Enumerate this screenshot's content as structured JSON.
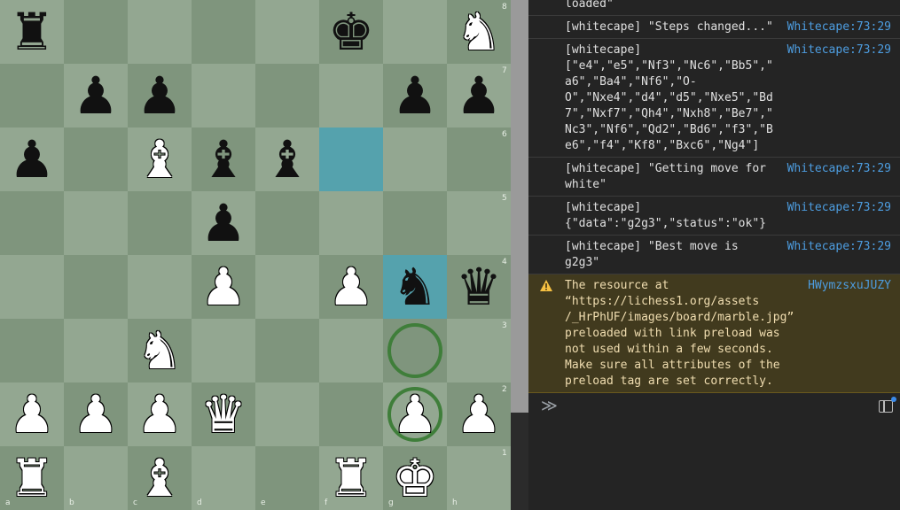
{
  "board": {
    "files": [
      "a",
      "b",
      "c",
      "d",
      "e",
      "f",
      "g",
      "h"
    ],
    "ranks": [
      "8",
      "7",
      "6",
      "5",
      "4",
      "3",
      "2",
      "1"
    ],
    "pieces": [
      {
        "square": "a8",
        "color": "black",
        "type": "rook",
        "glyph": "♜",
        "icon": "rook-icon"
      },
      {
        "square": "f8",
        "color": "black",
        "type": "king",
        "glyph": "♚",
        "icon": "king-icon"
      },
      {
        "square": "h8",
        "color": "white",
        "type": "knight",
        "glyph": "♞",
        "icon": "knight-icon"
      },
      {
        "square": "b7",
        "color": "black",
        "type": "pawn",
        "glyph": "♟",
        "icon": "pawn-icon"
      },
      {
        "square": "c7",
        "color": "black",
        "type": "pawn",
        "glyph": "♟",
        "icon": "pawn-icon"
      },
      {
        "square": "g7",
        "color": "black",
        "type": "pawn",
        "glyph": "♟",
        "icon": "pawn-icon"
      },
      {
        "square": "h7",
        "color": "black",
        "type": "pawn",
        "glyph": "♟",
        "icon": "pawn-icon"
      },
      {
        "square": "a6",
        "color": "black",
        "type": "pawn",
        "glyph": "♟",
        "icon": "pawn-icon"
      },
      {
        "square": "c6",
        "color": "white",
        "type": "bishop",
        "glyph": "♝",
        "icon": "bishop-icon"
      },
      {
        "square": "d6",
        "color": "black",
        "type": "bishop",
        "glyph": "♝",
        "icon": "bishop-icon"
      },
      {
        "square": "e6",
        "color": "black",
        "type": "bishop",
        "glyph": "♝",
        "icon": "bishop-icon"
      },
      {
        "square": "d5",
        "color": "black",
        "type": "pawn",
        "glyph": "♟",
        "icon": "pawn-icon"
      },
      {
        "square": "d4",
        "color": "white",
        "type": "pawn",
        "glyph": "♟",
        "icon": "pawn-icon"
      },
      {
        "square": "f4",
        "color": "white",
        "type": "pawn",
        "glyph": "♟",
        "icon": "pawn-icon"
      },
      {
        "square": "g4",
        "color": "black",
        "type": "knight",
        "glyph": "♞",
        "icon": "knight-icon"
      },
      {
        "square": "h4",
        "color": "black",
        "type": "queen",
        "glyph": "♛",
        "icon": "queen-icon"
      },
      {
        "square": "c3",
        "color": "white",
        "type": "knight",
        "glyph": "♞",
        "icon": "knight-icon"
      },
      {
        "square": "a2",
        "color": "white",
        "type": "pawn",
        "glyph": "♟",
        "icon": "pawn-icon"
      },
      {
        "square": "b2",
        "color": "white",
        "type": "pawn",
        "glyph": "♟",
        "icon": "pawn-icon"
      },
      {
        "square": "c2",
        "color": "white",
        "type": "pawn",
        "glyph": "♟",
        "icon": "pawn-icon"
      },
      {
        "square": "d2",
        "color": "white",
        "type": "queen",
        "glyph": "♛",
        "icon": "queen-icon"
      },
      {
        "square": "g2",
        "color": "white",
        "type": "pawn",
        "glyph": "♟",
        "icon": "pawn-icon"
      },
      {
        "square": "h2",
        "color": "white",
        "type": "pawn",
        "glyph": "♟",
        "icon": "pawn-icon"
      },
      {
        "square": "a1",
        "color": "white",
        "type": "rook",
        "glyph": "♜",
        "icon": "rook-icon"
      },
      {
        "square": "c1",
        "color": "white",
        "type": "bishop",
        "glyph": "♝",
        "icon": "bishop-icon"
      },
      {
        "square": "f1",
        "color": "white",
        "type": "rook",
        "glyph": "♜",
        "icon": "rook-icon"
      },
      {
        "square": "g1",
        "color": "white",
        "type": "king",
        "glyph": "♚",
        "icon": "king-icon"
      }
    ],
    "last_move_squares": [
      "f6",
      "g4"
    ],
    "move_destination_squares": [
      "g3",
      "g2"
    ],
    "colors": {
      "light": "#93a791",
      "dark": "#7f957d",
      "highlight": "#55a2ad",
      "ring": "#3f7e3a"
    }
  },
  "console": {
    "entries": [
      {
        "type": "log",
        "lines": [
          "loaded\""
        ],
        "source": ""
      },
      {
        "type": "log",
        "lines": [
          "[whitecape] \"Steps changed...\""
        ],
        "source": "Whitecape:73:29"
      },
      {
        "type": "log",
        "lines": [
          "[whitecape]",
          "[\"e4\",\"e5\",\"Nf3\",\"Nc6\",\"Bb5\",\"",
          "a6\",\"Ba4\",\"Nf6\",\"O-",
          "O\",\"Nxe4\",\"d4\",\"d5\",\"Nxe5\",\"Bd",
          "7\",\"Nxf7\",\"Qh4\",\"Nxh8\",\"Be7\",\"",
          "Nc3\",\"Nf6\",\"Qd2\",\"Bd6\",\"f3\",\"B",
          "e6\",\"f4\",\"Kf8\",\"Bxc6\",\"Ng4\"]"
        ],
        "source": "Whitecape:73:29"
      },
      {
        "type": "log",
        "lines": [
          "[whitecape] \"Getting move for",
          "white\""
        ],
        "source": "Whitecape:73:29"
      },
      {
        "type": "log",
        "lines": [
          "[whitecape]",
          "{\"data\":\"g2g3\",\"status\":\"ok\"}"
        ],
        "source": "Whitecape:73:29"
      },
      {
        "type": "log",
        "lines": [
          "[whitecape] \"Best move is",
          "g2g3\""
        ],
        "source": "Whitecape:73:29"
      },
      {
        "type": "warn",
        "lines": [
          "The resource at",
          "“https://lichess1.org/assets",
          "/_HrPhUF/images/board/marble.jpg”",
          "preloaded with link preload was",
          "not used within a few seconds.",
          "Make sure all attributes of the",
          "preload tag are set correctly."
        ],
        "source": "HWymzsxuJUZY"
      }
    ],
    "prompt_symbol": "≫",
    "warn_color": "#413a1e",
    "link_color": "#4d9de0"
  }
}
